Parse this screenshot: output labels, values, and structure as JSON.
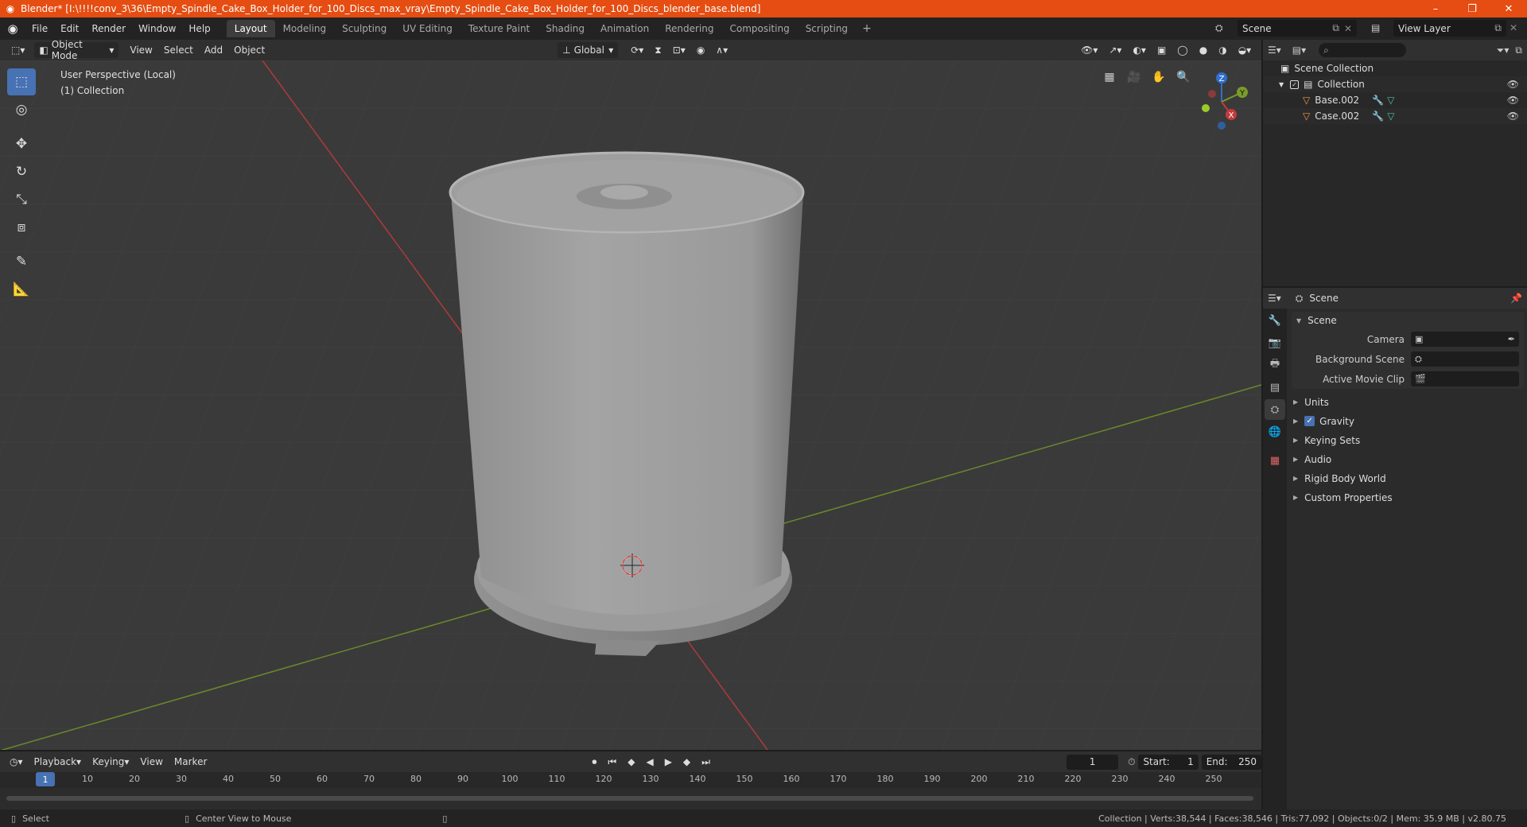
{
  "titlebar": {
    "title": "Blender* [I:\\!!!!conv_3\\36\\Empty_Spindle_Cake_Box_Holder_for_100_Discs_max_vray\\Empty_Spindle_Cake_Box_Holder_for_100_Discs_blender_base.blend]",
    "minimize": "–",
    "maximize": "❐",
    "close": "✕"
  },
  "menu": [
    "File",
    "Edit",
    "Render",
    "Window",
    "Help"
  ],
  "workspaces": [
    "Layout",
    "Modeling",
    "Sculpting",
    "UV Editing",
    "Texture Paint",
    "Shading",
    "Animation",
    "Rendering",
    "Compositing",
    "Scripting"
  ],
  "scene_selector": "Scene",
  "view_layer": "View Layer",
  "viewport_header": {
    "mode": "Object Mode",
    "menus": [
      "View",
      "Select",
      "Add",
      "Object"
    ],
    "orientation": "Global"
  },
  "viewport": {
    "perspective": "User Perspective (Local)",
    "collection": "(1) Collection"
  },
  "gizmo": {
    "z": "Z",
    "y": "Y",
    "x": "X"
  },
  "outliner": {
    "root": "Scene Collection",
    "collection": "Collection",
    "objects": [
      "Base.002",
      "Case.002"
    ]
  },
  "properties": {
    "header": "Scene",
    "panel_title": "Scene",
    "camera_label": "Camera",
    "background_label": "Background Scene",
    "movieclip_label": "Active Movie Clip",
    "subpanels": [
      "Units",
      "Gravity",
      "Keying Sets",
      "Audio",
      "Rigid Body World",
      "Custom Properties"
    ]
  },
  "timeline": {
    "menus": [
      "Playback",
      "Keying",
      "View",
      "Marker"
    ],
    "current_frame": "1",
    "start_label": "Start:",
    "start": "1",
    "end_label": "End:",
    "end": "250",
    "ticks": [
      "10",
      "20",
      "30",
      "40",
      "50",
      "60",
      "70",
      "80",
      "90",
      "100",
      "110",
      "120",
      "130",
      "140",
      "150",
      "160",
      "170",
      "180",
      "190",
      "200",
      "210",
      "220",
      "230",
      "240",
      "250"
    ]
  },
  "statusbar": {
    "select": "Select",
    "center": "Center View to Mouse",
    "stats": "Collection | Verts:38,544 | Faces:38,546 | Tris:77,092 | Objects:0/2 | Mem: 35.9 MB | v2.80.75"
  },
  "colors": {
    "accent": "#4772b3",
    "titlebar": "#e54d12",
    "viewport_bg": "#3a3a3a"
  }
}
